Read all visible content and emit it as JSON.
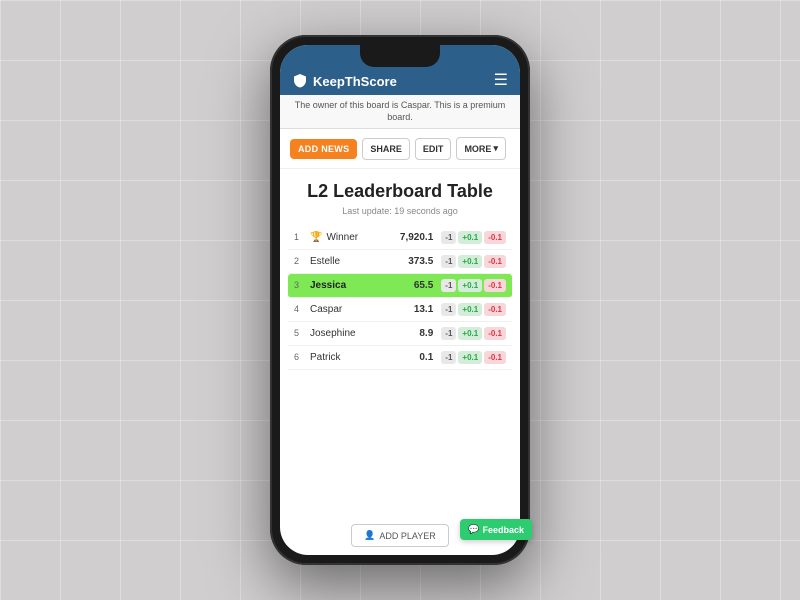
{
  "app": {
    "name": "KeepThScore",
    "premium_notice": "The owner of this board is Caspar. This is a premium board."
  },
  "toolbar": {
    "add_news_label": "ADD NEWS",
    "share_label": "SHARE",
    "edit_label": "EDIT",
    "more_label": "MORE"
  },
  "board": {
    "title": "L2 Leaderboard Table",
    "last_update": "Last update: 19 seconds ago"
  },
  "players": [
    {
      "rank": "1",
      "trophy": true,
      "name": "Winner",
      "score": "7,920.1",
      "highlighted": false
    },
    {
      "rank": "2",
      "trophy": false,
      "name": "Estelle",
      "score": "373.5",
      "highlighted": false
    },
    {
      "rank": "3",
      "trophy": false,
      "name": "Jessica",
      "score": "65.5",
      "highlighted": true
    },
    {
      "rank": "4",
      "trophy": false,
      "name": "Caspar",
      "score": "13.1",
      "highlighted": false
    },
    {
      "rank": "5",
      "trophy": false,
      "name": "Josephine",
      "score": "8.9",
      "highlighted": false
    },
    {
      "rank": "6",
      "trophy": false,
      "name": "Patrick",
      "score": "0.1",
      "highlighted": false
    }
  ],
  "score_buttons": {
    "minus": "-1",
    "plus": "+0.1",
    "minus_small": "-0.1"
  },
  "add_player_label": "ADD PLAYER",
  "feedback_label": "Feedback"
}
